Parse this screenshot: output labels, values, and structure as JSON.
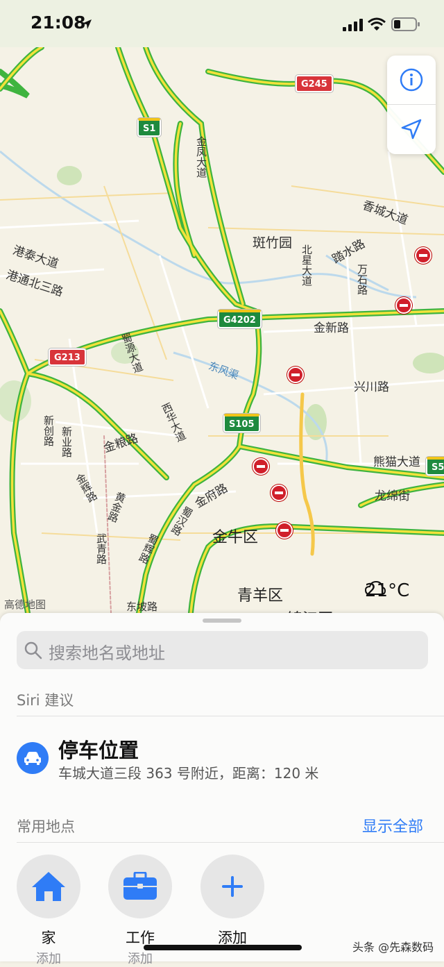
{
  "status_bar": {
    "time": "21:08"
  },
  "map": {
    "places": [
      {
        "text": "斑竹园"
      },
      {
        "text": "香城大道"
      },
      {
        "text": "港泰大道"
      },
      {
        "text": "港通北三路"
      },
      {
        "text": "金新路"
      },
      {
        "text": "兴川路"
      },
      {
        "text": "东风渠"
      },
      {
        "text": "金粮路"
      },
      {
        "text": "熊猫大道"
      },
      {
        "text": "龙绵街"
      },
      {
        "text": "金府路"
      },
      {
        "text": "东坡路"
      },
      {
        "text": "踏水路"
      }
    ],
    "vertical_roads": [
      {
        "text": "金凤大道"
      },
      {
        "text": "北星大道"
      },
      {
        "text": "万石路"
      },
      {
        "text": "蜀源大道"
      },
      {
        "text": "西华大道"
      },
      {
        "text": "新创路"
      },
      {
        "text": "新业路"
      },
      {
        "text": "金辉路"
      },
      {
        "text": "黄金路"
      },
      {
        "text": "蜀汉路"
      },
      {
        "text": "蜀辉路"
      },
      {
        "text": "武青路"
      }
    ],
    "districts": [
      {
        "text": "金牛区"
      },
      {
        "text": "青羊区"
      },
      {
        "text": "锦江区"
      }
    ],
    "shields": [
      {
        "text": "G245",
        "kind": "red"
      },
      {
        "text": "S1",
        "kind": "green"
      },
      {
        "text": "G4202",
        "kind": "green"
      },
      {
        "text": "G213",
        "kind": "red"
      },
      {
        "text": "S105",
        "kind": "green"
      },
      {
        "text": "S5",
        "kind": "green"
      }
    ],
    "attribution": "高德地图",
    "weather": {
      "temp": "21°C",
      "icon": "cloud-icon"
    }
  },
  "map_controls": {
    "info_icon": "info-icon",
    "locate_icon": "location-arrow-icon"
  },
  "sheet": {
    "search_placeholder": "搜索地名或地址",
    "siri_title": "Siri 建议",
    "parking": {
      "title": "停车位置",
      "subtitle": "车城大道三段 363 号附近，距离：120 米"
    },
    "favorites_title": "常用地点",
    "show_all": "显示全部",
    "favorites": [
      {
        "label": "家",
        "sub": "添加"
      },
      {
        "label": "工作",
        "sub": "添加"
      },
      {
        "label": "添加",
        "sub": ""
      }
    ],
    "accent": "#2f7cf6"
  },
  "watermark": "头条 @先森数码"
}
